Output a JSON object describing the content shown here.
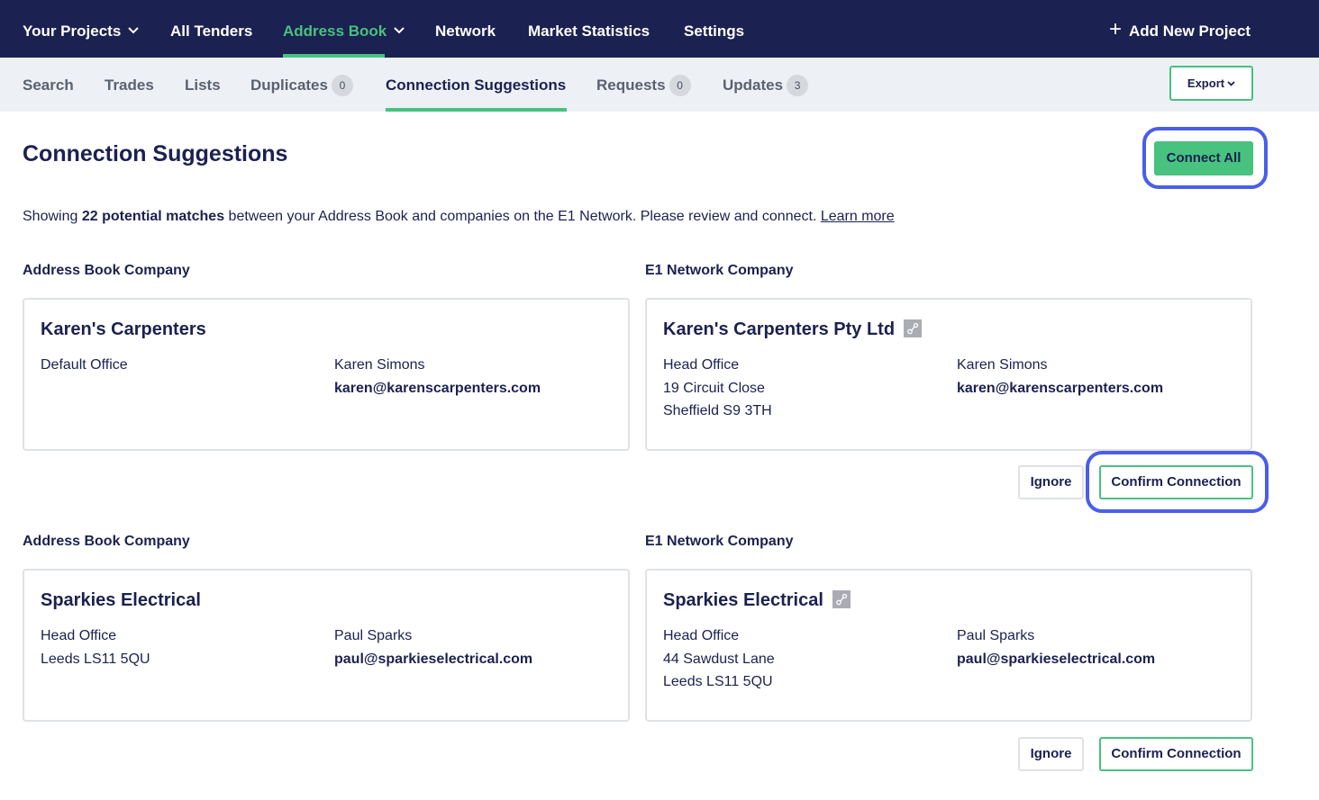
{
  "topnav": {
    "items": [
      {
        "label": "Your Projects",
        "has_dropdown": true
      },
      {
        "label": "All Tenders"
      },
      {
        "label": "Address Book",
        "has_dropdown": true,
        "active": true
      },
      {
        "label": "Network"
      },
      {
        "label": "Market Statistics"
      },
      {
        "label": "Settings"
      }
    ],
    "add_project_label": "Add New Project"
  },
  "subnav": {
    "items": [
      {
        "label": "Search"
      },
      {
        "label": "Trades"
      },
      {
        "label": "Lists"
      },
      {
        "label": "Duplicates",
        "badge": "0"
      },
      {
        "label": "Connection Suggestions",
        "active": true
      },
      {
        "label": "Requests",
        "badge": "0"
      },
      {
        "label": "Updates",
        "badge": "3"
      }
    ],
    "export_label": "Export"
  },
  "page": {
    "title": "Connection Suggestions",
    "connect_all_label": "Connect All",
    "summary_prefix": "Showing ",
    "summary_count": "22 potential matches",
    "summary_suffix": " between your Address Book and companies on the E1 Network. Please review and connect. ",
    "learn_more": "Learn more"
  },
  "labels": {
    "address_book_company": "Address Book Company",
    "e1_network_company": "E1 Network Company",
    "ignore": "Ignore",
    "confirm": "Confirm Connection"
  },
  "suggestions": [
    {
      "address_book": {
        "name": "Karen's Carpenters",
        "office": "Default Office",
        "address_lines": [],
        "contact": "Karen Simons",
        "email": "karen@karenscarpenters.com"
      },
      "network": {
        "name": "Karen's Carpenters Pty Ltd",
        "office": "Head Office",
        "address_lines": [
          "19 Circuit Close",
          "Sheffield S9 3TH"
        ],
        "contact": "Karen Simons",
        "email": "karen@karenscarpenters.com"
      }
    },
    {
      "address_book": {
        "name": "Sparkies Electrical",
        "office": "Head Office",
        "address_lines": [
          "Leeds LS11 5QU"
        ],
        "contact": "Paul Sparks",
        "email": "paul@sparkieselectrical.com"
      },
      "network": {
        "name": "Sparkies Electrical",
        "office": "Head Office",
        "address_lines": [
          "44 Sawdust Lane",
          "Leeds LS11 5QU"
        ],
        "contact": "Paul Sparks",
        "email": "paul@sparkieselectrical.com"
      }
    }
  ],
  "colors": {
    "nav_bg": "#1b2150",
    "accent": "#47c27f",
    "highlight_ring": "#4a5ee8"
  }
}
